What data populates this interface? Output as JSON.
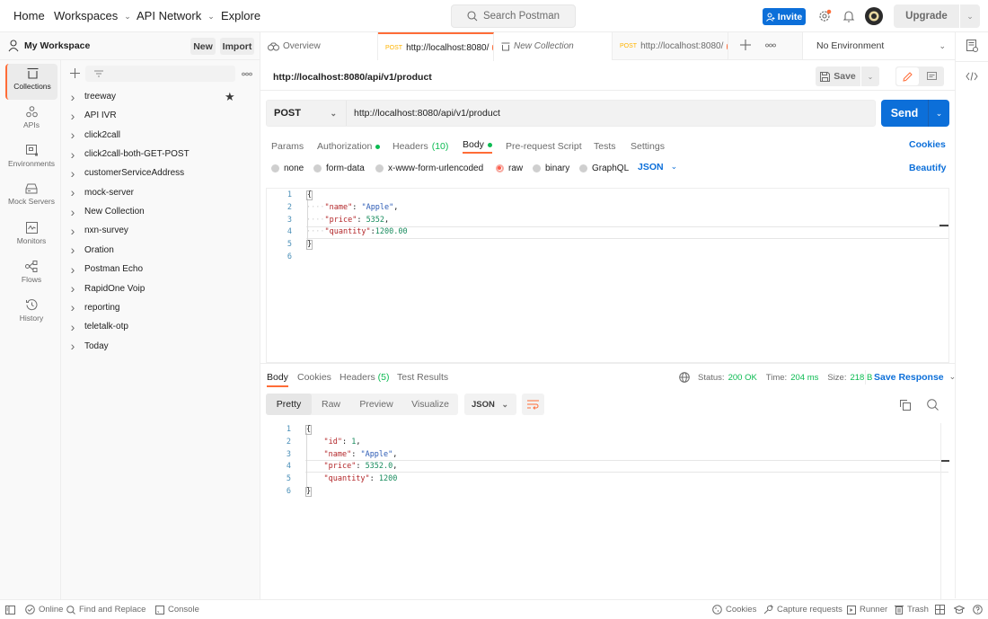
{
  "topbar": {
    "nav": [
      {
        "label": "Home",
        "has_caret": false
      },
      {
        "label": "Workspaces",
        "has_caret": true
      },
      {
        "label": "API Network",
        "has_caret": true
      },
      {
        "label": "Explore",
        "has_caret": false
      }
    ],
    "search_placeholder": "Search Postman",
    "invite_label": "Invite",
    "upgrade_label": "Upgrade"
  },
  "workspace": {
    "name": "My Workspace",
    "new_label": "New",
    "import_label": "Import"
  },
  "tabs": [
    {
      "label": "Overview",
      "type": "overview",
      "active": false
    },
    {
      "method": "POST",
      "label": "http://localhost:8080/",
      "type": "request",
      "active": true,
      "unsaved": true
    },
    {
      "label": "New Collection",
      "type": "collection",
      "active": false,
      "italic": true
    },
    {
      "method": "POST",
      "label": "http://localhost:8080/",
      "type": "request",
      "active": false,
      "unsaved": true
    }
  ],
  "environment": {
    "selected": "No Environment"
  },
  "left_rail": [
    {
      "label": "Collections",
      "icon": "collections-icon",
      "active": true
    },
    {
      "label": "APIs",
      "icon": "apis-icon",
      "active": false
    },
    {
      "label": "Environments",
      "icon": "environments-icon",
      "active": false
    },
    {
      "label": "Mock Servers",
      "icon": "mock-servers-icon",
      "active": false
    },
    {
      "label": "Monitors",
      "icon": "monitors-icon",
      "active": false
    },
    {
      "label": "Flows",
      "icon": "flows-icon",
      "active": false
    },
    {
      "label": "History",
      "icon": "history-icon",
      "active": false
    }
  ],
  "collections": [
    {
      "name": "treeway",
      "starred": true
    },
    {
      "name": "API IVR"
    },
    {
      "name": "click2call"
    },
    {
      "name": "click2call-both-GET-POST"
    },
    {
      "name": "customerServiceAddress"
    },
    {
      "name": "mock-server"
    },
    {
      "name": "New Collection"
    },
    {
      "name": "nxn-survey"
    },
    {
      "name": "Oration"
    },
    {
      "name": "Postman Echo"
    },
    {
      "name": "RapidOne Voip"
    },
    {
      "name": "reporting"
    },
    {
      "name": "teletalk-otp"
    },
    {
      "name": "Today"
    }
  ],
  "request": {
    "title": "http://localhost:8080/api/v1/product",
    "save_label": "Save",
    "method": "POST",
    "url": "http://localhost:8080/api/v1/product",
    "send_label": "Send",
    "tabs": [
      {
        "label": "Params"
      },
      {
        "label": "Authorization",
        "dot": true
      },
      {
        "label": "Headers",
        "count": "(10)"
      },
      {
        "label": "Body",
        "dot": true,
        "active": true
      },
      {
        "label": "Pre-request Script"
      },
      {
        "label": "Tests"
      },
      {
        "label": "Settings"
      }
    ],
    "cookies_label": "Cookies",
    "body_types": [
      {
        "label": "none",
        "selected": false
      },
      {
        "label": "form-data",
        "selected": false
      },
      {
        "label": "x-www-form-urlencoded",
        "selected": false
      },
      {
        "label": "raw",
        "selected": true
      },
      {
        "label": "binary",
        "selected": false
      },
      {
        "label": "GraphQL",
        "selected": false
      }
    ],
    "raw_format": "JSON",
    "beautify_label": "Beautify",
    "body_lines": [
      "{",
      "    \"name\": \"Apple\",",
      "    \"price\": 5352,",
      "    \"quantity\":1200.00",
      "}",
      ""
    ]
  },
  "response": {
    "tabs": [
      {
        "label": "Body",
        "active": true
      },
      {
        "label": "Cookies"
      },
      {
        "label": "Headers",
        "count": "(5)"
      },
      {
        "label": "Test Results"
      }
    ],
    "status_label": "Status:",
    "status_value": "200 OK",
    "time_label": "Time:",
    "time_value": "204 ms",
    "size_label": "Size:",
    "size_value": "218 B",
    "save_response_label": "Save Response",
    "views": [
      {
        "label": "Pretty",
        "active": true
      },
      {
        "label": "Raw"
      },
      {
        "label": "Preview"
      },
      {
        "label": "Visualize"
      }
    ],
    "format": "JSON",
    "body_lines": [
      "{",
      "    \"id\": 1,",
      "    \"name\": \"Apple\",",
      "    \"price\": 5352.0,",
      "    \"quantity\": 1200",
      "}"
    ]
  },
  "statusbar": {
    "online_label": "Online",
    "find_replace_label": "Find and Replace",
    "console_label": "Console",
    "cookies_label": "Cookies",
    "capture_label": "Capture requests",
    "runner_label": "Runner",
    "trash_label": "Trash"
  },
  "colors": {
    "accent": "#ff6c37",
    "primary": "#0c6fd9",
    "success": "#0cbb52",
    "post_method": "#ffb400"
  }
}
